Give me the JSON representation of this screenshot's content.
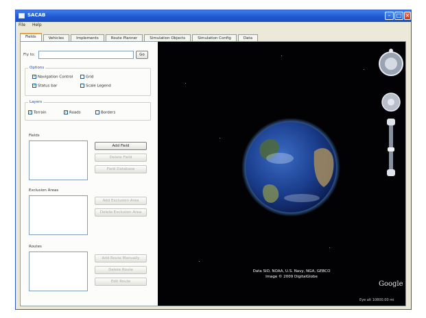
{
  "window": {
    "title": "SACAB"
  },
  "menu": {
    "items": [
      "File",
      "Help"
    ]
  },
  "tabs": [
    "Fields",
    "Vehicles",
    "Implements",
    "Route Planner",
    "Simulation Objects",
    "Simulation Config",
    "Data"
  ],
  "left": {
    "fly_to_label": "Fly to:",
    "fly_to_value": "",
    "go_label": "Go",
    "options": {
      "title": "Options",
      "items": [
        {
          "label": "Navigation Control",
          "checked": true
        },
        {
          "label": "Grid",
          "checked": false
        },
        {
          "label": "Status bar",
          "checked": true
        },
        {
          "label": "Scale Legend",
          "checked": false
        }
      ]
    },
    "layers": {
      "title": "Layers",
      "items": [
        {
          "label": "Terrain",
          "checked": true
        },
        {
          "label": "Roads",
          "checked": true
        },
        {
          "label": "Borders",
          "checked": false
        }
      ]
    },
    "fields": {
      "title": "Fields",
      "buttons": [
        "Add Field",
        "Delete Field",
        "Field Database"
      ]
    },
    "exclusion": {
      "title": "Exclusion Areas",
      "buttons": [
        "Add Exclusion Area",
        "Delete Exclusion Area"
      ]
    },
    "routes": {
      "title": "Routes",
      "buttons": [
        "Add Route Manually",
        "Delete Route",
        "Edit Route"
      ]
    }
  },
  "map": {
    "attribution_line1": "Data SIO, NOAA, U.S. Navy, NGA, GEBCO",
    "attribution_line2": "Image © 2009 DigitalGlobe",
    "logo": "Google",
    "eye_alt": "Eye alt 10800.00 mi"
  },
  "colors": {
    "titlebar": "#1f58d0",
    "accent_tab": "#f0a030",
    "map_bg": "#020205"
  }
}
